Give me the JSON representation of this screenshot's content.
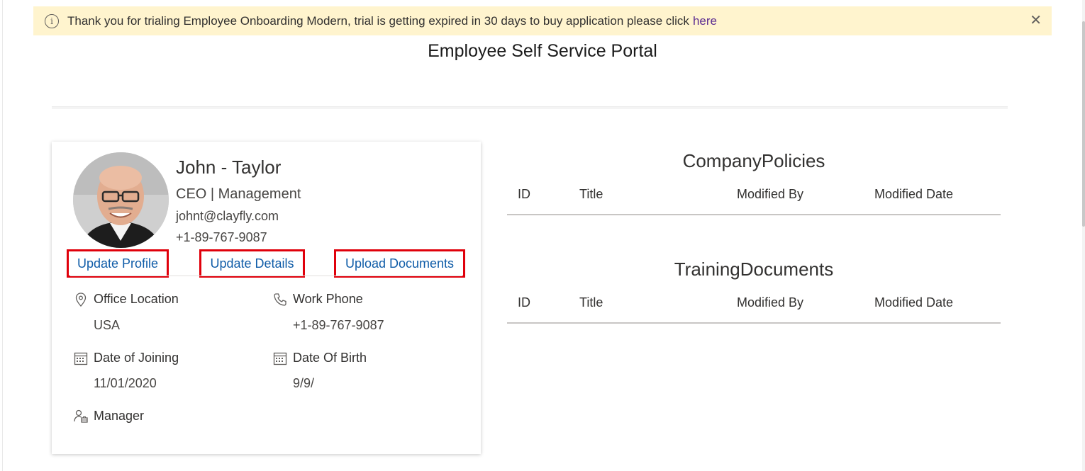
{
  "banner": {
    "text": "Thank you for trialing Employee Onboarding Modern, trial is getting expired in 30 days to buy application please click",
    "link": "here",
    "close": "✕"
  },
  "portal": {
    "title": "Employee Self Service Portal"
  },
  "profile": {
    "name": "John - Taylor",
    "role": "CEO | Management",
    "email": "johnt@clayfly.com",
    "phone": "+1-89-767-9087",
    "actions": {
      "update_profile": "Update Profile",
      "update_details": "Update Details",
      "upload_documents": "Upload Documents"
    },
    "fields": {
      "office_location_label": "Office Location",
      "office_location_value": "USA",
      "work_phone_label": "Work Phone",
      "work_phone_value": "+1-89-767-9087",
      "date_of_joining_label": "Date of Joining",
      "date_of_joining_value": "11/01/2020",
      "date_of_birth_label": "Date Of Birth",
      "date_of_birth_value": "9/9/",
      "manager_label": "Manager"
    }
  },
  "company_policies": {
    "title": "CompanyPolicies",
    "columns": [
      "ID",
      "Title",
      "Modified By",
      "Modified Date"
    ]
  },
  "training_documents": {
    "title": "TrainingDocuments",
    "columns": [
      "ID",
      "Title",
      "Modified By",
      "Modified Date"
    ]
  },
  "colors": {
    "banner_bg": "#fff4ce",
    "link": "#5c2d91",
    "action_text": "#0f5ca8",
    "action_highlight": "#e0000b"
  }
}
